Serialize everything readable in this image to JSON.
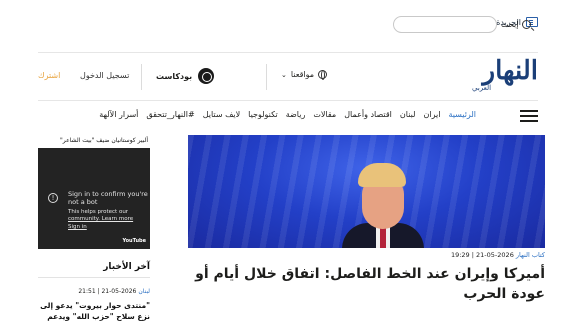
{
  "topbar": {
    "paper_label": "الجريدة",
    "search_label": "إبحث",
    "search_placeholder": ""
  },
  "header": {
    "logo_text": "النهار",
    "logo_sub": "العربي",
    "lang_label": "مواقعنا",
    "podcast_label": "بودكاست",
    "login_label": "تسجيل الدخول",
    "subscribe_label": "اشترك"
  },
  "nav": {
    "items": [
      {
        "label": "الرئيسية"
      },
      {
        "label": "ايران"
      },
      {
        "label": "لبنان"
      },
      {
        "label": "اقتصاد وأعمال"
      },
      {
        "label": "مقالات"
      },
      {
        "label": "رياضة"
      },
      {
        "label": "تكنولوجيا"
      },
      {
        "label": "لايف ستايل"
      },
      {
        "label": "#النهار_تتحقق"
      },
      {
        "label": "أسرار الآلهة"
      }
    ]
  },
  "hero": {
    "tag": "كتاب النهار",
    "date": "2026-05-21 | 19:29",
    "title": "أميركا وإيران عند الخط الفاصل: اتفاق خلال أيام أو عودة الحرب"
  },
  "sidebar": {
    "video_caption": "ألبير كوستانيان ضيف \"بيت الشاعر\"",
    "video_msg1": "Sign in to confirm you're",
    "video_msg2": "not a bot",
    "video_msg3": "This helps protect our",
    "video_msg4": "community. Learn more",
    "video_msg5": "Sign in",
    "video_brand": "YouTube",
    "latest_title": "آخر الأخبار",
    "latest_tag": "لبنان",
    "latest_date": "2026-05-21 | 21:51",
    "latest_item": "\"منتدى حوار بيروت\" يدعو إلى نزع سلاح \"حزب الله\" ويدعم مفاوضات"
  },
  "colors": {
    "brand": "#1b3f78",
    "accent": "#2a6fc2",
    "subscribe": "#e8a33d"
  }
}
